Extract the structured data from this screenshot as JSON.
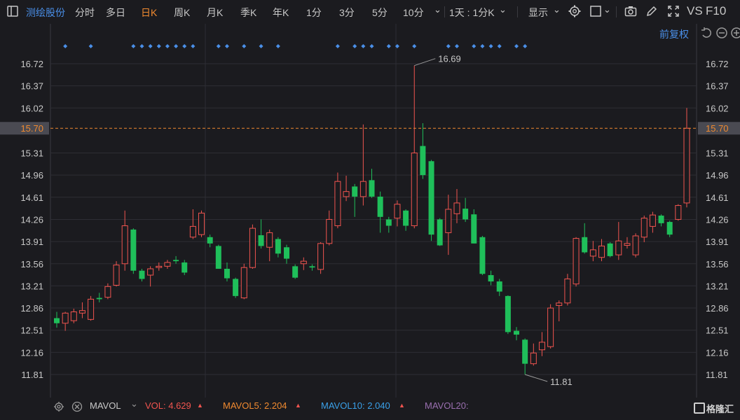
{
  "toolbar": {
    "stock_name": "测绘股份",
    "periods": [
      "分时",
      "多日",
      "日K",
      "周K",
      "月K",
      "季K",
      "年K",
      "1分",
      "3分",
      "5分",
      "10分"
    ],
    "active_period": "日K",
    "interval": "1天 : 1分K",
    "display": "显示",
    "vs": "VS",
    "f10": "F10"
  },
  "adjust_label": "前复权",
  "volume_bar": {
    "label": "MAVOL",
    "vol": "VOL: 4.629",
    "mavol5": "MAVOL5: 2.204",
    "mavol10": "MAVOL10: 2.040",
    "mavol20": "MAVOL20:",
    "colors": {
      "vol": "#f0544f",
      "mavol5": "#f08a30",
      "mavol10": "#3aa0e8",
      "mavol20": "#9a6fb0"
    }
  },
  "logo": "格隆汇",
  "chart_data": {
    "type": "candlestick",
    "y_ticks": [
      "16.72",
      "16.37",
      "16.02",
      "15.70",
      "15.31",
      "14.96",
      "14.61",
      "14.26",
      "13.91",
      "13.56",
      "13.21",
      "12.86",
      "12.51",
      "12.16",
      "11.81"
    ],
    "ylim": [
      11.81,
      16.72
    ],
    "current_price": "15.70",
    "high_label": "16.69",
    "low_label": "11.81",
    "colors": {
      "up": "#f0544f",
      "down": "#1fbf5a",
      "grid": "#2e2e34",
      "last": "#f08a30"
    },
    "candles": [
      {
        "o": 12.7,
        "h": 12.8,
        "l": 12.55,
        "c": 12.62
      },
      {
        "o": 12.62,
        "h": 12.8,
        "l": 12.5,
        "c": 12.78
      },
      {
        "o": 12.66,
        "h": 12.85,
        "l": 12.62,
        "c": 12.8
      },
      {
        "o": 12.78,
        "h": 12.95,
        "l": 12.7,
        "c": 12.82
      },
      {
        "o": 12.68,
        "h": 13.05,
        "l": 12.66,
        "c": 13.0
      },
      {
        "o": 13.02,
        "h": 13.1,
        "l": 12.95,
        "c": 13.0
      },
      {
        "o": 13.03,
        "h": 13.25,
        "l": 13.0,
        "c": 13.2
      },
      {
        "o": 13.22,
        "h": 13.6,
        "l": 13.2,
        "c": 13.54
      },
      {
        "o": 13.56,
        "h": 14.4,
        "l": 13.45,
        "c": 14.16
      },
      {
        "o": 14.1,
        "h": 14.12,
        "l": 13.4,
        "c": 13.45
      },
      {
        "o": 13.45,
        "h": 13.48,
        "l": 13.28,
        "c": 13.32
      },
      {
        "o": 13.38,
        "h": 13.52,
        "l": 13.2,
        "c": 13.48
      },
      {
        "o": 13.5,
        "h": 13.58,
        "l": 13.45,
        "c": 13.52
      },
      {
        "o": 13.52,
        "h": 13.62,
        "l": 13.48,
        "c": 13.58
      },
      {
        "o": 13.62,
        "h": 13.68,
        "l": 13.56,
        "c": 13.6
      },
      {
        "o": 13.58,
        "h": 13.62,
        "l": 13.38,
        "c": 13.42
      },
      {
        "o": 13.98,
        "h": 14.42,
        "l": 13.95,
        "c": 14.15
      },
      {
        "o": 14.02,
        "h": 14.4,
        "l": 13.98,
        "c": 14.36
      },
      {
        "o": 13.98,
        "h": 14.02,
        "l": 13.82,
        "c": 13.88
      },
      {
        "o": 13.84,
        "h": 13.86,
        "l": 13.48,
        "c": 13.48
      },
      {
        "o": 13.48,
        "h": 13.58,
        "l": 13.28,
        "c": 13.33
      },
      {
        "o": 13.32,
        "h": 13.34,
        "l": 13.02,
        "c": 13.05
      },
      {
        "o": 13.02,
        "h": 13.56,
        "l": 13.0,
        "c": 13.5
      },
      {
        "o": 13.5,
        "h": 14.18,
        "l": 13.48,
        "c": 14.12
      },
      {
        "o": 14.01,
        "h": 14.26,
        "l": 13.8,
        "c": 13.84
      },
      {
        "o": 13.82,
        "h": 14.1,
        "l": 13.6,
        "c": 14.05
      },
      {
        "o": 13.95,
        "h": 13.98,
        "l": 13.66,
        "c": 13.72
      },
      {
        "o": 13.82,
        "h": 13.86,
        "l": 13.56,
        "c": 13.64
      },
      {
        "o": 13.52,
        "h": 13.55,
        "l": 13.32,
        "c": 13.34
      },
      {
        "o": 13.56,
        "h": 13.66,
        "l": 13.46,
        "c": 13.6
      },
      {
        "o": 13.52,
        "h": 13.55,
        "l": 13.45,
        "c": 13.5
      },
      {
        "o": 13.47,
        "h": 13.9,
        "l": 13.4,
        "c": 13.88
      },
      {
        "o": 13.88,
        "h": 14.4,
        "l": 13.85,
        "c": 14.26
      },
      {
        "o": 14.16,
        "h": 15.0,
        "l": 14.12,
        "c": 14.86
      },
      {
        "o": 14.62,
        "h": 14.95,
        "l": 14.55,
        "c": 14.7
      },
      {
        "o": 14.78,
        "h": 14.82,
        "l": 14.3,
        "c": 14.62
      },
      {
        "o": 14.62,
        "h": 15.76,
        "l": 14.48,
        "c": 14.86
      },
      {
        "o": 14.88,
        "h": 15.06,
        "l": 14.6,
        "c": 14.62
      },
      {
        "o": 14.62,
        "h": 14.7,
        "l": 14.05,
        "c": 14.3
      },
      {
        "o": 14.26,
        "h": 14.3,
        "l": 14.05,
        "c": 14.16
      },
      {
        "o": 14.28,
        "h": 14.56,
        "l": 14.15,
        "c": 14.5
      },
      {
        "o": 14.4,
        "h": 14.42,
        "l": 14.08,
        "c": 14.16
      },
      {
        "o": 14.16,
        "h": 16.69,
        "l": 14.12,
        "c": 15.31
      },
      {
        "o": 15.42,
        "h": 15.78,
        "l": 14.9,
        "c": 14.96
      },
      {
        "o": 15.18,
        "h": 15.2,
        "l": 13.92,
        "c": 14.02
      },
      {
        "o": 14.26,
        "h": 14.28,
        "l": 13.84,
        "c": 13.85
      },
      {
        "o": 14.05,
        "h": 14.65,
        "l": 13.7,
        "c": 14.42
      },
      {
        "o": 14.35,
        "h": 14.74,
        "l": 14.2,
        "c": 14.52
      },
      {
        "o": 14.43,
        "h": 14.6,
        "l": 14.22,
        "c": 14.26
      },
      {
        "o": 14.34,
        "h": 14.42,
        "l": 13.88,
        "c": 13.88
      },
      {
        "o": 13.98,
        "h": 14.0,
        "l": 13.38,
        "c": 13.4
      },
      {
        "o": 13.38,
        "h": 13.45,
        "l": 13.22,
        "c": 13.28
      },
      {
        "o": 13.28,
        "h": 13.32,
        "l": 13.05,
        "c": 13.12
      },
      {
        "o": 13.05,
        "h": 13.06,
        "l": 12.45,
        "c": 12.48
      },
      {
        "o": 12.5,
        "h": 12.56,
        "l": 12.35,
        "c": 12.44
      },
      {
        "o": 12.36,
        "h": 12.38,
        "l": 11.81,
        "c": 11.98
      },
      {
        "o": 11.98,
        "h": 12.3,
        "l": 11.95,
        "c": 12.15
      },
      {
        "o": 12.2,
        "h": 12.48,
        "l": 12.1,
        "c": 12.32
      },
      {
        "o": 12.25,
        "h": 12.92,
        "l": 12.22,
        "c": 12.86
      },
      {
        "o": 12.9,
        "h": 12.98,
        "l": 12.65,
        "c": 12.94
      },
      {
        "o": 12.94,
        "h": 13.4,
        "l": 12.9,
        "c": 13.32
      },
      {
        "o": 13.24,
        "h": 13.98,
        "l": 13.2,
        "c": 13.96
      },
      {
        "o": 13.98,
        "h": 14.2,
        "l": 13.72,
        "c": 13.74
      },
      {
        "o": 13.68,
        "h": 13.92,
        "l": 13.6,
        "c": 13.78
      },
      {
        "o": 13.66,
        "h": 13.95,
        "l": 13.6,
        "c": 13.84
      },
      {
        "o": 13.88,
        "h": 13.9,
        "l": 13.66,
        "c": 13.68
      },
      {
        "o": 13.7,
        "h": 14.22,
        "l": 13.62,
        "c": 13.92
      },
      {
        "o": 13.85,
        "h": 13.98,
        "l": 13.8,
        "c": 13.88
      },
      {
        "o": 13.7,
        "h": 14.04,
        "l": 13.66,
        "c": 14.0
      },
      {
        "o": 13.98,
        "h": 14.32,
        "l": 13.9,
        "c": 14.28
      },
      {
        "o": 14.15,
        "h": 14.38,
        "l": 14.05,
        "c": 14.33
      },
      {
        "o": 14.32,
        "h": 14.34,
        "l": 14.15,
        "c": 14.2
      },
      {
        "o": 14.22,
        "h": 14.24,
        "l": 13.98,
        "c": 14.02
      },
      {
        "o": 14.26,
        "h": 14.5,
        "l": 14.24,
        "c": 14.48
      },
      {
        "o": 14.52,
        "h": 16.02,
        "l": 14.45,
        "c": 15.7
      }
    ]
  }
}
